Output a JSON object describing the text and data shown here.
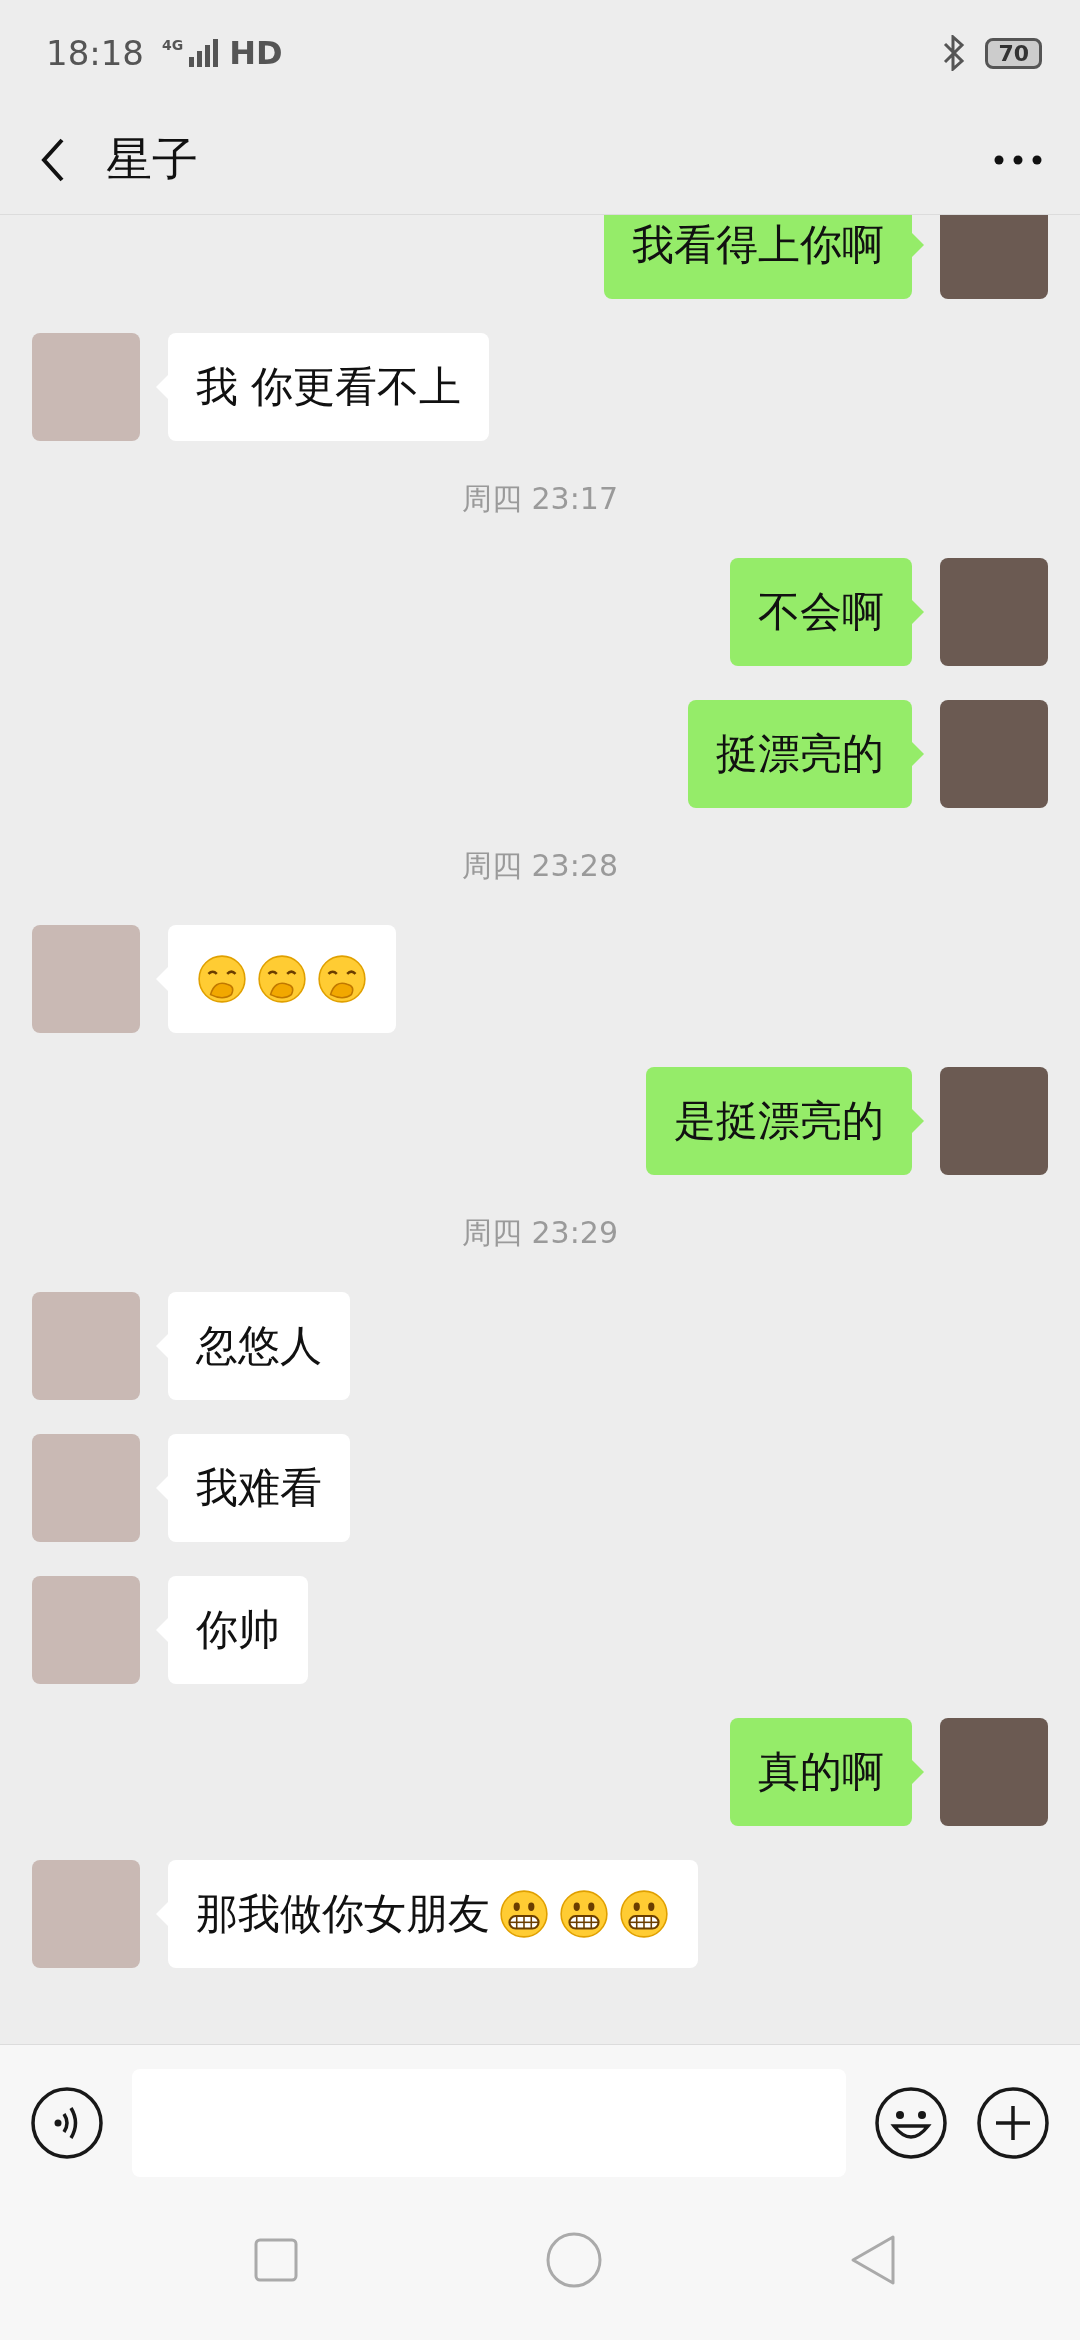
{
  "status_bar": {
    "time": "18:18",
    "network": "4G",
    "hd": "HD",
    "battery": "70"
  },
  "header": {
    "title": "星子"
  },
  "messages": [
    {
      "kind": "message",
      "outgoing": true,
      "parts": [
        {
          "kind": "text",
          "text": "我看得上你啊"
        }
      ]
    },
    {
      "kind": "message",
      "outgoing": false,
      "parts": [
        {
          "kind": "text",
          "text": "我 你更看不上"
        }
      ]
    },
    {
      "kind": "time",
      "text": "周四 23:17"
    },
    {
      "kind": "message",
      "outgoing": true,
      "parts": [
        {
          "kind": "text",
          "text": "不会啊"
        }
      ]
    },
    {
      "kind": "message",
      "outgoing": true,
      "parts": [
        {
          "kind": "text",
          "text": "挺漂亮的"
        }
      ]
    },
    {
      "kind": "time",
      "text": "周四 23:28"
    },
    {
      "kind": "message",
      "outgoing": false,
      "parts": [
        {
          "kind": "giggle"
        },
        {
          "kind": "giggle"
        },
        {
          "kind": "giggle"
        }
      ]
    },
    {
      "kind": "message",
      "outgoing": true,
      "parts": [
        {
          "kind": "text",
          "text": "是挺漂亮的"
        }
      ]
    },
    {
      "kind": "time",
      "text": "周四 23:29"
    },
    {
      "kind": "message",
      "outgoing": false,
      "parts": [
        {
          "kind": "text",
          "text": "忽悠人"
        }
      ]
    },
    {
      "kind": "message",
      "outgoing": false,
      "parts": [
        {
          "kind": "text",
          "text": "我难看"
        }
      ]
    },
    {
      "kind": "message",
      "outgoing": false,
      "parts": [
        {
          "kind": "text",
          "text": "你帅"
        }
      ]
    },
    {
      "kind": "message",
      "outgoing": true,
      "parts": [
        {
          "kind": "text",
          "text": "真的啊"
        }
      ]
    },
    {
      "kind": "message",
      "outgoing": false,
      "parts": [
        {
          "kind": "text",
          "text": "那我做你女朋友"
        },
        {
          "kind": "grimace"
        },
        {
          "kind": "grimace"
        },
        {
          "kind": "grimace"
        }
      ]
    }
  ]
}
